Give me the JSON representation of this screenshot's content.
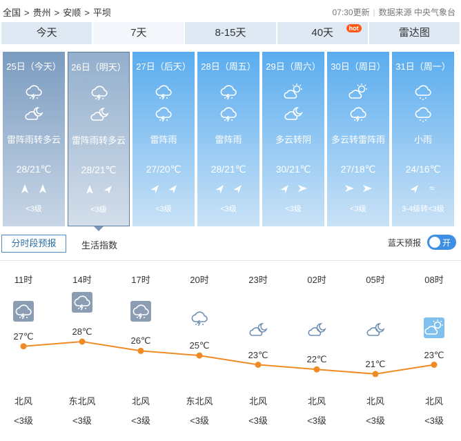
{
  "breadcrumb": {
    "items": [
      "全国",
      "贵州",
      "安顺",
      "平坝"
    ],
    "separator": ">"
  },
  "header": {
    "update_time": "07:30更新",
    "source": "数据来源 中央气象台"
  },
  "tabs": [
    {
      "label": "今天"
    },
    {
      "label": "7天"
    },
    {
      "label": "8-15天"
    },
    {
      "label": "40天",
      "badge": "hot"
    },
    {
      "label": "雷达图"
    }
  ],
  "days": [
    {
      "date": "25日（今天）",
      "icon1": "thunder-rain-icon",
      "icon2": "partly-cloudy-night-icon",
      "desc": "雷阵雨转多云",
      "temp": "28/21℃",
      "wind1": "north",
      "wind2": "north",
      "level": "<3级"
    },
    {
      "date": "26日（明天）",
      "icon1": "thunder-rain-icon",
      "icon2": "partly-cloudy-night-icon",
      "desc": "雷阵雨转多云",
      "temp": "28/21℃",
      "wind1": "north",
      "wind2": "northeast",
      "level": "<3级"
    },
    {
      "date": "27日（后天）",
      "icon1": "thunder-rain-icon",
      "icon2": "thunder-rain-icon",
      "desc": "雷阵雨",
      "temp": "27/20℃",
      "wind1": "northeast",
      "wind2": "northeast",
      "level": "<3级"
    },
    {
      "date": "28日（周五）",
      "icon1": "thunder-rain-icon",
      "icon2": "thunder-rain-icon",
      "desc": "雷阵雨",
      "temp": "28/21℃",
      "wind1": "northeast",
      "wind2": "northeast",
      "level": "<3级"
    },
    {
      "date": "29日（周六）",
      "icon1": "partly-cloudy-day-icon",
      "icon2": "partly-cloudy-night-icon",
      "desc": "多云转阴",
      "temp": "30/21℃",
      "wind1": "northeast",
      "wind2": "east",
      "level": "<3级"
    },
    {
      "date": "30日（周日）",
      "icon1": "partly-cloudy-day-icon",
      "icon2": "thunder-rain-icon",
      "desc": "多云转雷阵雨",
      "temp": "27/18℃",
      "wind1": "east",
      "wind2": "east",
      "level": "<3级"
    },
    {
      "date": "31日（周一）",
      "icon1": "rain-icon",
      "icon2": "rain-icon",
      "desc": "小雨",
      "temp": "24/16℃",
      "wind1": "northeast",
      "wind2": "variable",
      "level": "3-4级转<3级"
    }
  ],
  "subtabs": {
    "hourly": "分时段预报",
    "index": "生活指数"
  },
  "blue_sky": {
    "label": "蓝天预报",
    "toggle": "开"
  },
  "hourly": {
    "times": [
      "11时",
      "14时",
      "17时",
      "20时",
      "23时",
      "02时",
      "05时",
      "08时"
    ],
    "temps": [
      27,
      28,
      26,
      25,
      23,
      22,
      21,
      23
    ],
    "temp_labels": [
      "27℃",
      "28℃",
      "26℃",
      "25℃",
      "23℃",
      "22℃",
      "21℃",
      "23℃"
    ],
    "icons": [
      "thunder-rain-icon",
      "thunder-rain-icon",
      "thunder-rain-icon",
      "thunder-rain-icon",
      "cloudy-night-icon",
      "cloudy-night-icon",
      "cloudy-night-icon",
      "partly-cloudy-day-icon"
    ],
    "winds": [
      "北风",
      "东北风",
      "北风",
      "东北风",
      "北风",
      "北风",
      "北风",
      "北风"
    ],
    "levels": [
      "<3级",
      "<3级",
      "<3级",
      "<3级",
      "<3级",
      "<3级",
      "<3级",
      "<3级"
    ]
  },
  "colors": {
    "accent": "#3d8fe3",
    "temp_line": "#f08a24",
    "tab_bg": "#dfe9f4"
  }
}
